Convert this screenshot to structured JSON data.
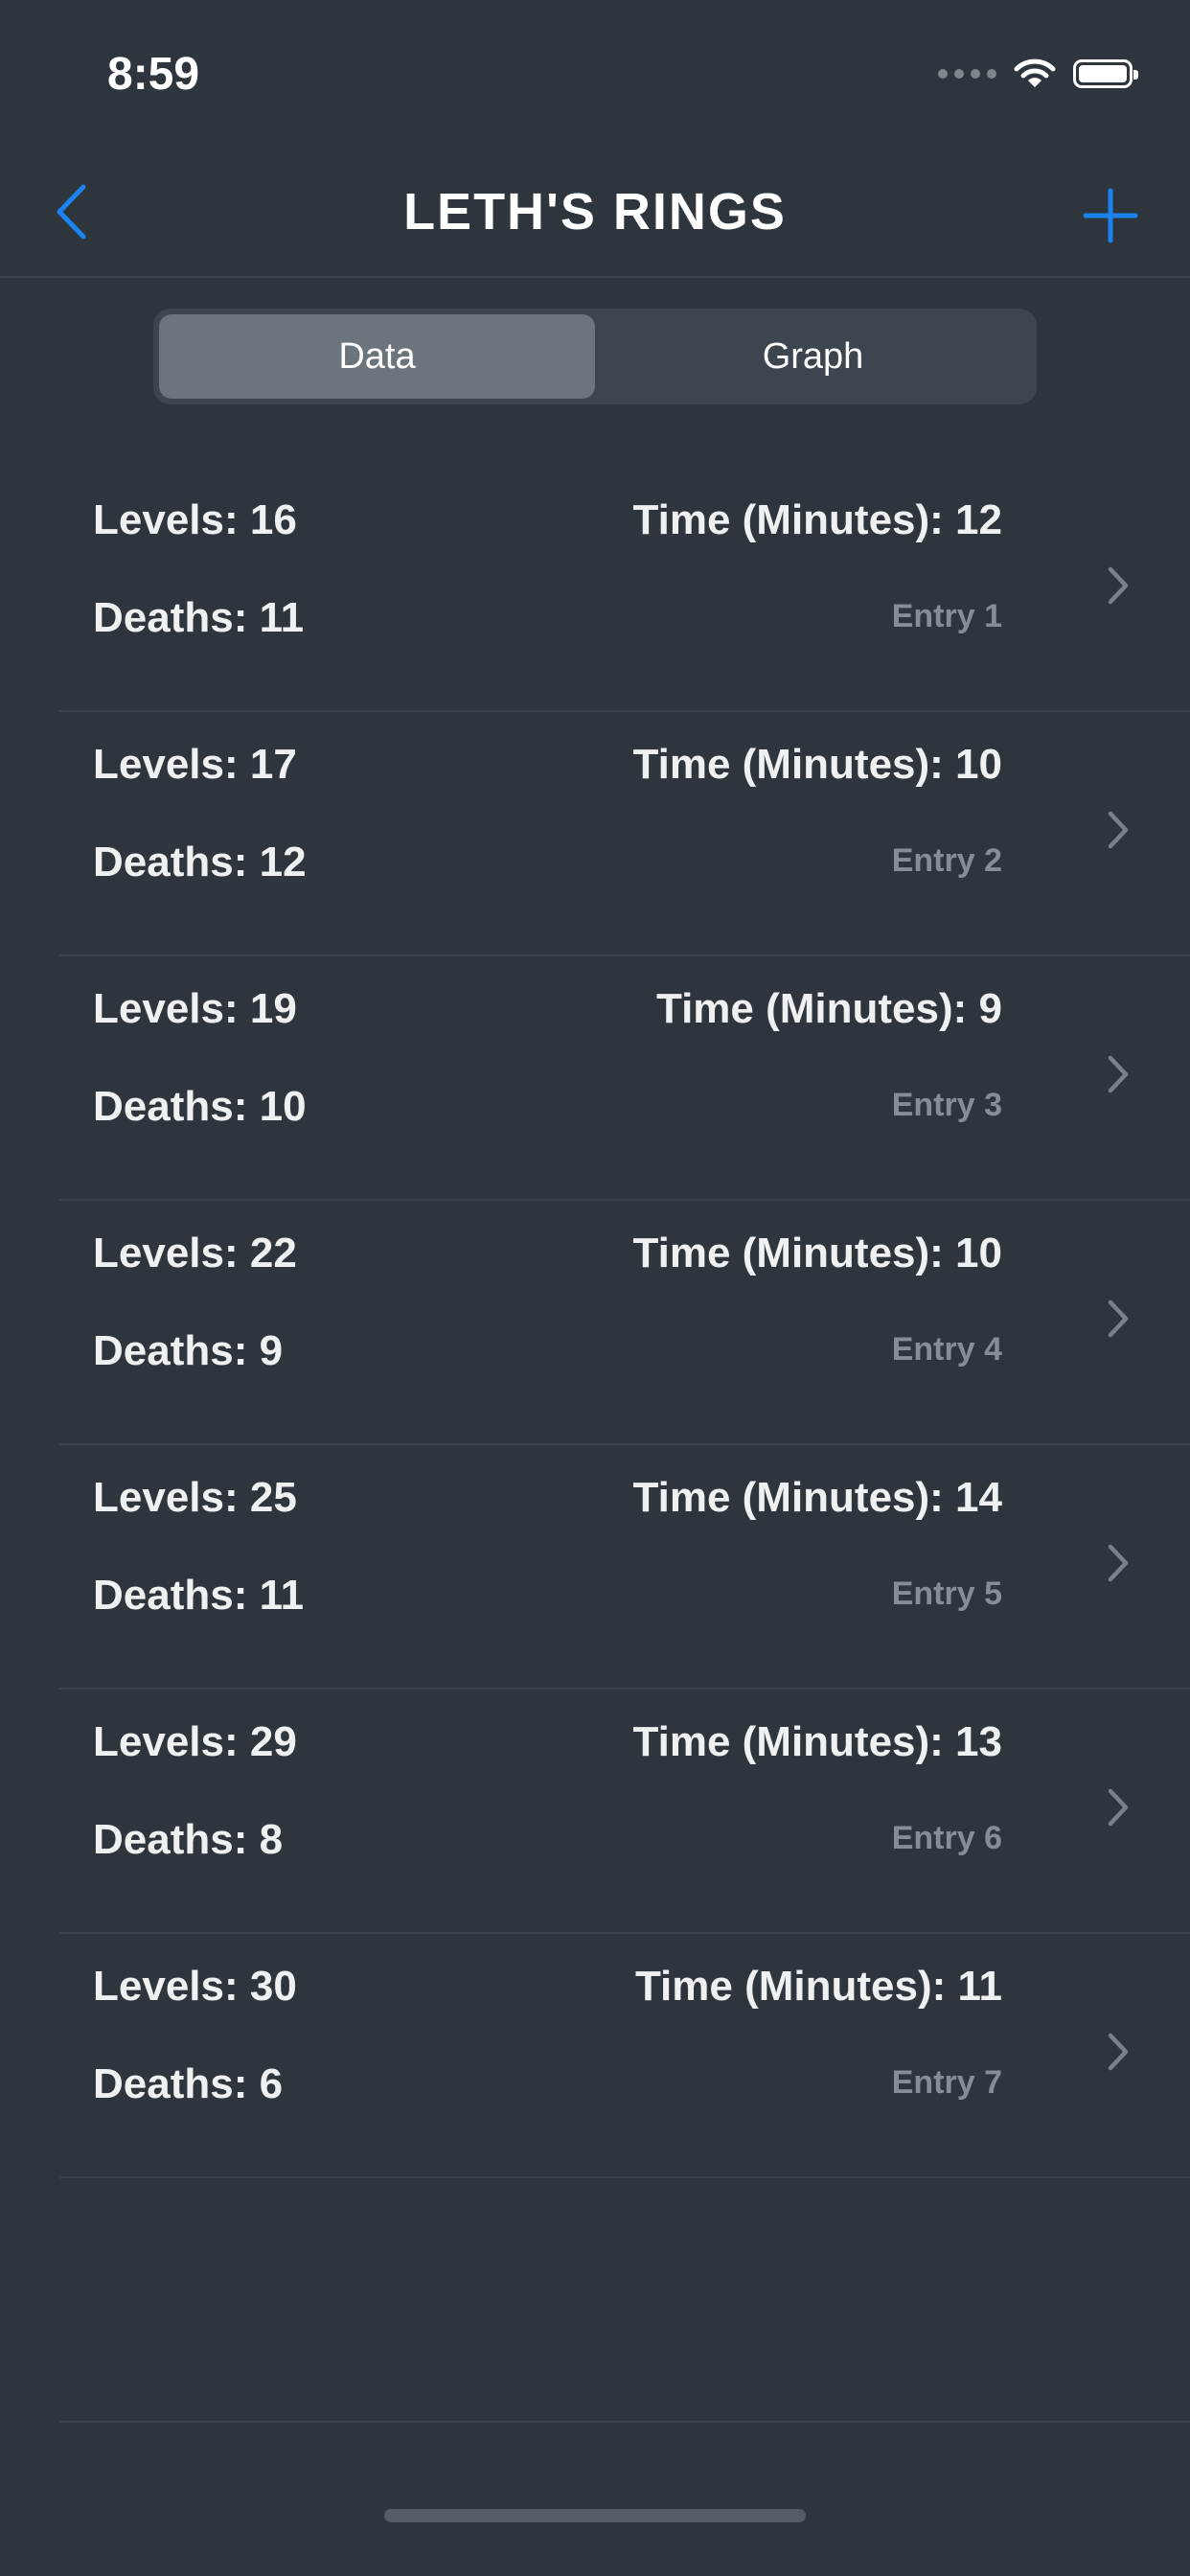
{
  "status_bar": {
    "time": "8:59"
  },
  "nav": {
    "title": "LETH'S RINGS",
    "accent_color": "#1a83f0"
  },
  "segments": [
    {
      "label": "Data",
      "selected": true
    },
    {
      "label": "Graph",
      "selected": false
    }
  ],
  "entries": [
    {
      "levels": "Levels: 16",
      "minutes": "Time (Minutes): 12",
      "deaths": "Deaths: 11",
      "entry": "Entry 1"
    },
    {
      "levels": "Levels: 17",
      "minutes": "Time (Minutes): 10",
      "deaths": "Deaths: 12",
      "entry": "Entry 2"
    },
    {
      "levels": "Levels: 19",
      "minutes": "Time (Minutes): 9",
      "deaths": "Deaths: 10",
      "entry": "Entry 3"
    },
    {
      "levels": "Levels: 22",
      "minutes": "Time (Minutes): 10",
      "deaths": "Deaths: 9",
      "entry": "Entry 4"
    },
    {
      "levels": "Levels: 25",
      "minutes": "Time (Minutes): 14",
      "deaths": "Deaths: 11",
      "entry": "Entry 5"
    },
    {
      "levels": "Levels: 29",
      "minutes": "Time (Minutes): 13",
      "deaths": "Deaths: 8",
      "entry": "Entry 6"
    },
    {
      "levels": "Levels: 30",
      "minutes": "Time (Minutes): 11",
      "deaths": "Deaths: 6",
      "entry": "Entry 7"
    }
  ],
  "icons": {
    "back": "chevron-left-icon",
    "add": "plus-icon",
    "row": "chevron-right-icon",
    "wifi": "wifi-icon",
    "battery": "battery-icon",
    "signal": "cellular-signal-icon"
  }
}
